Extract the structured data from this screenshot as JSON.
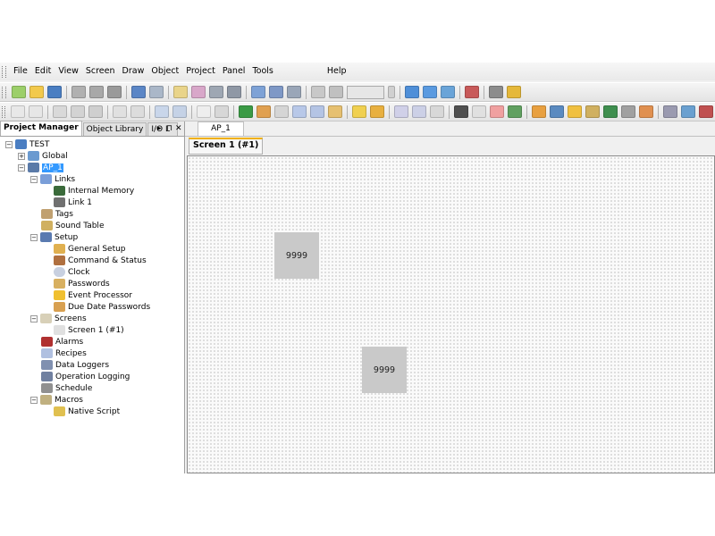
{
  "menubar": {
    "items": [
      "File",
      "Edit",
      "View",
      "Screen",
      "Draw",
      "Object",
      "Project",
      "Panel",
      "Tools",
      "Help"
    ]
  },
  "left_panel": {
    "tabs": [
      "Project Manager",
      "Object Library",
      "I/O L"
    ],
    "pin_symbol": "⊓",
    "close_symbol": "✕",
    "arrow_symbol": "▸"
  },
  "tree": {
    "project": "TEST",
    "global": "Global",
    "ap": "AP_1",
    "links": "Links",
    "internal_memory": "Internal Memory",
    "link1": "Link 1",
    "tags": "Tags",
    "sound_table": "Sound Table",
    "setup": "Setup",
    "general_setup": "General Setup",
    "command_status": "Command & Status",
    "clock": "Clock",
    "passwords": "Passwords",
    "event_processor": "Event Processor",
    "due_date_passwords": "Due Date Passwords",
    "screens": "Screens",
    "screen1": "Screen 1 (#1)",
    "alarms": "Alarms",
    "recipes": "Recipes",
    "data_loggers": "Data Loggers",
    "operation_logging": "Operation Logging",
    "schedule": "Schedule",
    "macros": "Macros",
    "native_script": "Native Script"
  },
  "document": {
    "tab": "AP_1",
    "screen_tab": "Screen 1 (#1)",
    "display1_value": "9999",
    "display2_value": "9999"
  },
  "colors": {
    "selection": "#3399ff",
    "screen_tab_accent": "#f0b000",
    "display_fill": "#c9c9c9"
  }
}
